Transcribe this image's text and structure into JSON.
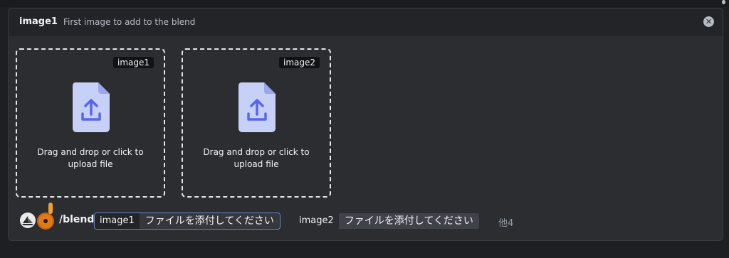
{
  "header": {
    "option_name": "image1",
    "option_description": "First image to add to the blend",
    "close_symbol": "✕"
  },
  "dropzones": [
    {
      "tag": "image1",
      "text": "Drag and drop or click to upload file"
    },
    {
      "tag": "image2",
      "text": "Drag and drop or click to upload file"
    }
  ],
  "command": {
    "name": "/blend",
    "options": [
      {
        "key": "image1",
        "value": "ファイルを添付してください"
      },
      {
        "key": "image2",
        "value": "ファイルを添付してください"
      }
    ],
    "more_label": "他4"
  },
  "colors": {
    "background": "#1e1f22",
    "panel": "#2b2d31",
    "upload_icon_bg": "#c7d0f6",
    "upload_icon_fg": "#5865f2"
  }
}
